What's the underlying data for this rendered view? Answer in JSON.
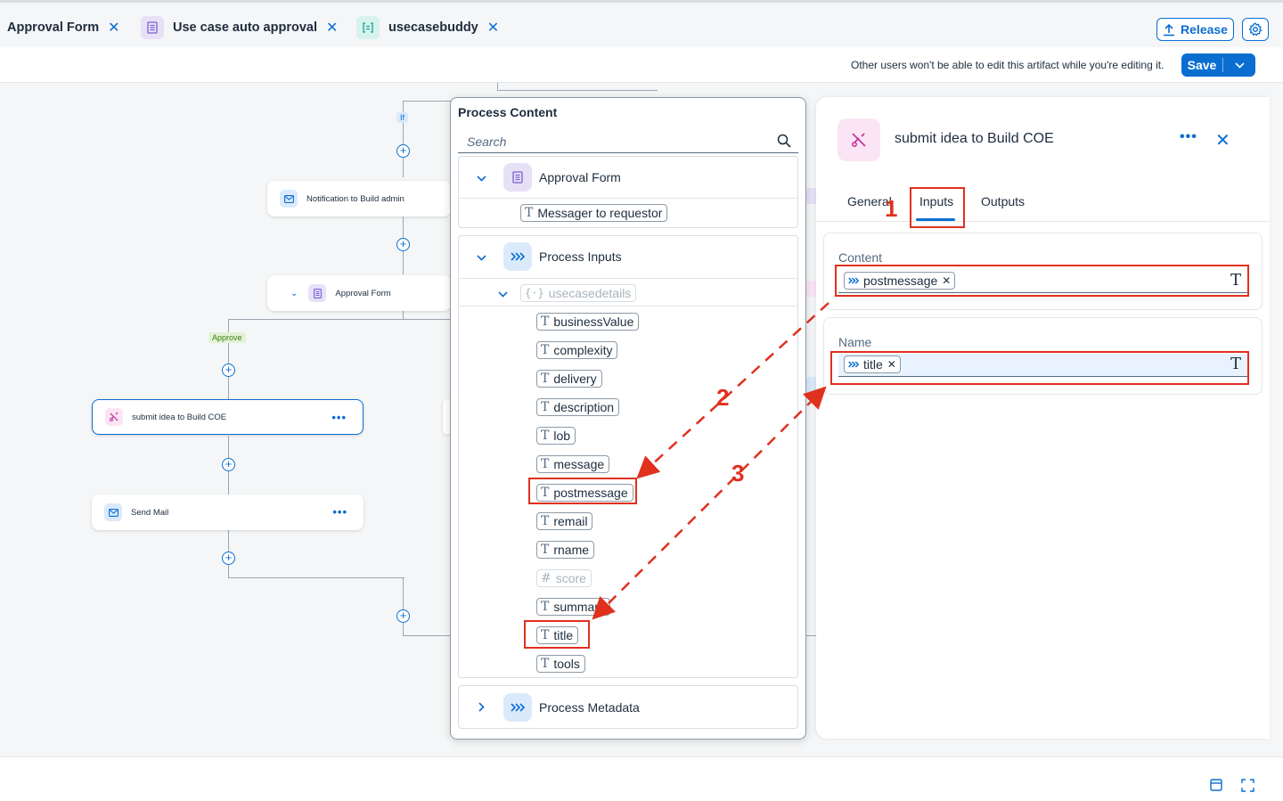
{
  "tabs": [
    {
      "label": "Approval Form",
      "close": "✕"
    },
    {
      "label": "Use case auto approval",
      "close": "✕"
    },
    {
      "label": "usecasebuddy",
      "close": "✕"
    }
  ],
  "header": {
    "release_label": "Release"
  },
  "toolbar": {
    "message": "Other users won't be able to edit this artifact while you're editing it.",
    "save_label": "Save"
  },
  "canvas": {
    "if_tag": "If",
    "approve_tag": "Approve",
    "nodes": {
      "notification": "Notification to Build admin",
      "approval_form": "Approval Form",
      "submit_idea": "submit idea to Build COE",
      "send_mail": "Send Mail"
    }
  },
  "process_content": {
    "title": "Process Content",
    "search_placeholder": "Search",
    "approval_form": {
      "label": "Approval Form",
      "items": [
        "Messager to requestor"
      ]
    },
    "process_inputs": {
      "label": "Process Inputs",
      "object": "usecasedetails",
      "items": [
        "businessValue",
        "complexity",
        "delivery",
        "description",
        "lob",
        "message",
        "postmessage",
        "remail",
        "rname",
        "score",
        "summary",
        "title",
        "tools"
      ]
    },
    "process_metadata": {
      "label": "Process Metadata"
    }
  },
  "properties": {
    "title": "submit idea to Build COE",
    "tabs": [
      "General",
      "Inputs",
      "Outputs"
    ],
    "active_tab": "Inputs",
    "fields": [
      {
        "label": "Content",
        "value": "postmessage"
      },
      {
        "label": "Name",
        "value": "title"
      }
    ]
  },
  "annotations": [
    "1",
    "2",
    "3"
  ],
  "colors": {
    "accent": "#0a6ed1",
    "annotation": "#e0301e"
  }
}
